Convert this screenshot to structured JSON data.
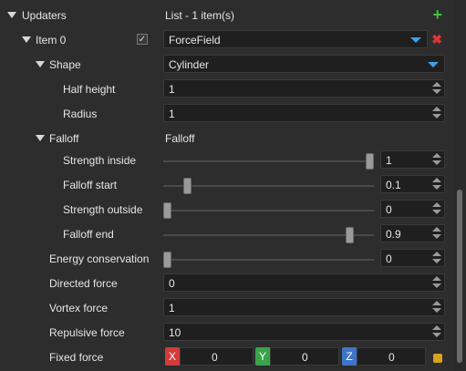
{
  "updaters": {
    "label": "Updaters",
    "value": "List - 1 item(s)",
    "add_icon": "plus-icon"
  },
  "item0": {
    "label": "Item 0",
    "checked": true,
    "value": "ForceField",
    "remove_icon": "close-icon"
  },
  "shape": {
    "label": "Shape",
    "value": "Cylinder",
    "half_height": {
      "label": "Half height",
      "value": "1"
    },
    "radius": {
      "label": "Radius",
      "value": "1"
    }
  },
  "falloff": {
    "label": "Falloff",
    "value": "Falloff",
    "strength_inside": {
      "label": "Strength inside",
      "value": "1",
      "slider_fraction": 1.0
    },
    "falloff_start": {
      "label": "Falloff start",
      "value": "0.1",
      "slider_fraction": 0.1
    },
    "strength_outside": {
      "label": "Strength outside",
      "value": "0",
      "slider_fraction": 0.0
    },
    "falloff_end": {
      "label": "Falloff end",
      "value": "0.9",
      "slider_fraction": 0.9
    }
  },
  "energy_conservation": {
    "label": "Energy conservation",
    "value": "0",
    "slider_fraction": 0.0
  },
  "directed_force": {
    "label": "Directed force",
    "value": "0"
  },
  "vortex_force": {
    "label": "Vortex force",
    "value": "1"
  },
  "repulsive_force": {
    "label": "Repulsive force",
    "value": "10"
  },
  "fixed_force": {
    "label": "Fixed force",
    "x_label": "X",
    "x": "0",
    "y_label": "Y",
    "y": "0",
    "z_label": "Z",
    "z": "0",
    "lock_icon": "lock-icon"
  },
  "colors": {
    "background": "#2d2d2d",
    "field": "#1f1f1f",
    "accent_blue": "#3fa0e8",
    "x_red": "#d33b3b",
    "y_green": "#3aa34a",
    "z_blue": "#3f74c7"
  }
}
